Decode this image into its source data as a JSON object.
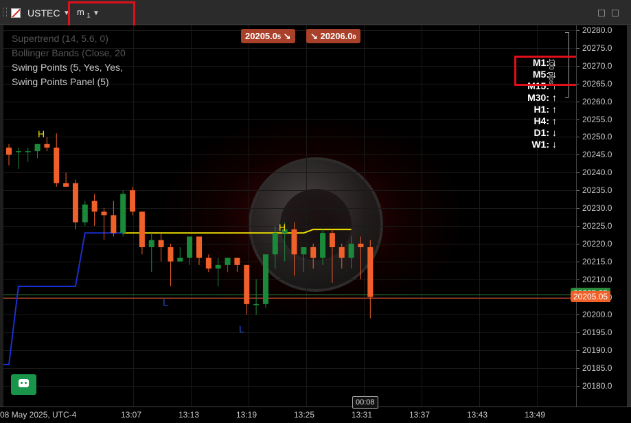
{
  "header": {
    "symbol": "USTEC",
    "timeframe_main": "m",
    "timeframe_sub": "1"
  },
  "indicators": [
    {
      "label": "Supertrend (14, 5.6, 0)",
      "color": "#555555"
    },
    {
      "label": "Bollinger Bands (Close, 20",
      "color": "#555555"
    },
    {
      "label": "Swing Points (5, Yes, Yes,",
      "color": "#c8c8c8"
    },
    {
      "label": "Swing Points Panel (5)",
      "color": "#c8c8c8"
    }
  ],
  "trade": {
    "sell_price": "20205.0",
    "sell_price_small": "5",
    "buy_price": "20206.0",
    "buy_price_small": "0"
  },
  "mtf_panel": [
    {
      "label": "M1:",
      "arrow": "↓"
    },
    {
      "label": "M5:",
      "arrow": "↓"
    },
    {
      "label": "M15:",
      "arrow": "↑"
    },
    {
      "label": "M30:",
      "arrow": "↑"
    },
    {
      "label": "H1:",
      "arrow": "↑"
    },
    {
      "label": "H4:",
      "arrow": "↑"
    },
    {
      "label": "D1:",
      "arrow": "↓"
    },
    {
      "label": "W1:",
      "arrow": "↓"
    }
  ],
  "pips_label": "100 pips",
  "price_axis": [
    "20280.0",
    "20275.0",
    "20270.0",
    "20265.0",
    "20260.0",
    "20255.0",
    "20250.0",
    "20245.0",
    "20240.0",
    "20235.0",
    "20230.0",
    "20225.0",
    "20220.0",
    "20215.0",
    "20210.0",
    "20205.0",
    "20200.0",
    "20195.0",
    "20190.0",
    "20185.0",
    "20180.0"
  ],
  "current_price_tag": "20205.05",
  "current_price_tag_hidden": "20205.05",
  "time_axis": {
    "date_label": "08 May 2025, UTC-4",
    "ticks": [
      "13:07",
      "13:13",
      "13:19",
      "13:25",
      "13:31",
      "13:37",
      "13:43",
      "13:49"
    ]
  },
  "countdown": "00:08",
  "swing_labels": [
    {
      "text": "H",
      "color": "#f0e000"
    },
    {
      "text": "H",
      "color": "#f0e000"
    },
    {
      "text": "L",
      "color": "#2050e0"
    },
    {
      "text": "L",
      "color": "#2050e0"
    }
  ],
  "colors": {
    "bull": "#1a8a3a",
    "bear": "#f0602a",
    "supertrend_down": "#1a2fd0",
    "supertrend_up": "#f0e000",
    "price_line_red": "#e05030",
    "price_line_green": "#2a8a3a"
  },
  "chart_data": {
    "type": "candlestick",
    "symbol": "USTEC",
    "timeframe": "m1",
    "x_ticks": [
      "13:07",
      "13:13",
      "13:19",
      "13:25",
      "13:31",
      "13:37",
      "13:43",
      "13:49"
    ],
    "ylim": [
      20178,
      20282
    ],
    "candles": [
      {
        "o": 20247,
        "h": 20248,
        "l": 20242,
        "c": 20245
      },
      {
        "o": 20246,
        "h": 20247,
        "l": 20241,
        "c": 20246
      },
      {
        "o": 20246,
        "h": 20247,
        "l": 20243,
        "c": 20246
      },
      {
        "o": 20246,
        "h": 20248,
        "l": 20244,
        "c": 20248
      },
      {
        "o": 20248,
        "h": 20250,
        "l": 20246,
        "c": 20247
      },
      {
        "o": 20247,
        "h": 20251,
        "l": 20236,
        "c": 20237
      },
      {
        "o": 20237,
        "h": 20240,
        "l": 20236,
        "c": 20236
      },
      {
        "o": 20237,
        "h": 20238,
        "l": 20224,
        "c": 20226
      },
      {
        "o": 20226,
        "h": 20232,
        "l": 20225,
        "c": 20231
      },
      {
        "o": 20232,
        "h": 20234,
        "l": 20225,
        "c": 20229
      },
      {
        "o": 20229,
        "h": 20230,
        "l": 20221,
        "c": 20228
      },
      {
        "o": 20228,
        "h": 20232,
        "l": 20222,
        "c": 20223
      },
      {
        "o": 20223,
        "h": 20235,
        "l": 20222,
        "c": 20234
      },
      {
        "o": 20235,
        "h": 20236,
        "l": 20228,
        "c": 20229
      },
      {
        "o": 20229,
        "h": 20229,
        "l": 20217,
        "c": 20219
      },
      {
        "o": 20219,
        "h": 20223,
        "l": 20212,
        "c": 20221
      },
      {
        "o": 20221,
        "h": 20223,
        "l": 20215,
        "c": 20219
      },
      {
        "o": 20219,
        "h": 20220,
        "l": 20208,
        "c": 20215
      },
      {
        "o": 20215,
        "h": 20219,
        "l": 20215,
        "c": 20216
      },
      {
        "o": 20216,
        "h": 20222,
        "l": 20214,
        "c": 20222
      },
      {
        "o": 20222,
        "h": 20222,
        "l": 20214,
        "c": 20216
      },
      {
        "o": 20216,
        "h": 20217,
        "l": 20212,
        "c": 20213
      },
      {
        "o": 20213,
        "h": 20216,
        "l": 20208,
        "c": 20214
      },
      {
        "o": 20214,
        "h": 20216,
        "l": 20212,
        "c": 20216
      },
      {
        "o": 20216,
        "h": 20216,
        "l": 20212,
        "c": 20214
      },
      {
        "o": 20214,
        "h": 20214,
        "l": 20200,
        "c": 20203
      },
      {
        "o": 20203,
        "h": 20210,
        "l": 20200,
        "c": 20203
      },
      {
        "o": 20203,
        "h": 20209,
        "l": 20202,
        "c": 20217
      },
      {
        "o": 20217,
        "h": 20225,
        "l": 20213,
        "c": 20223
      },
      {
        "o": 20223,
        "h": 20226,
        "l": 20215,
        "c": 20224
      },
      {
        "o": 20224,
        "h": 20226,
        "l": 20211,
        "c": 20217
      },
      {
        "o": 20217,
        "h": 20219,
        "l": 20212,
        "c": 20219
      },
      {
        "o": 20219,
        "h": 20220,
        "l": 20213,
        "c": 20216
      },
      {
        "o": 20216,
        "h": 20224,
        "l": 20214,
        "c": 20223
      },
      {
        "o": 20223,
        "h": 20224,
        "l": 20209,
        "c": 20219
      },
      {
        "o": 20219,
        "h": 20220,
        "l": 20213,
        "c": 20216
      },
      {
        "o": 20216,
        "h": 20222,
        "l": 20213,
        "c": 20220
      },
      {
        "o": 20220,
        "h": 20222,
        "l": 20210,
        "c": 20219
      },
      {
        "o": 20219,
        "h": 20221,
        "l": 20199,
        "c": 20205
      }
    ],
    "supertrend_blue": [
      [
        -1,
        20186
      ],
      [
        0,
        20186
      ],
      [
        1,
        20208
      ],
      [
        7,
        20208
      ],
      [
        8,
        20223
      ],
      [
        12,
        20223
      ]
    ],
    "supertrend_yellow": [
      [
        12,
        20223
      ],
      [
        31,
        20223
      ],
      [
        32,
        20224
      ],
      [
        36,
        20224
      ]
    ],
    "current_price": 20205.05
  }
}
